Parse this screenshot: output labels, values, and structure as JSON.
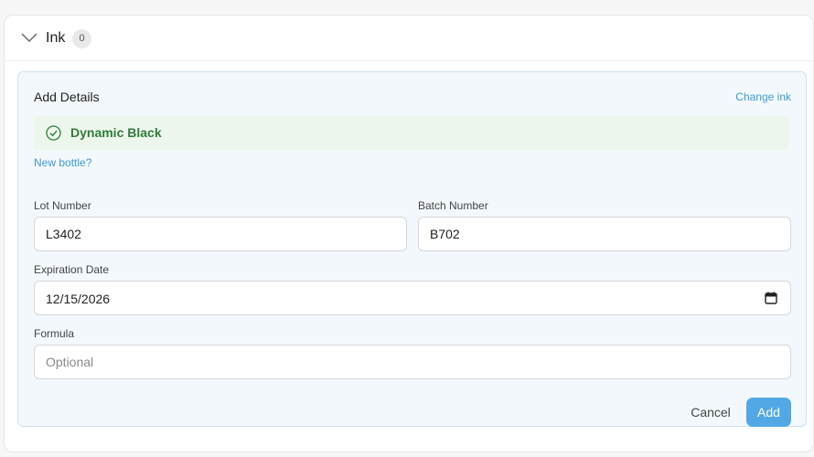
{
  "header": {
    "title": "Ink",
    "count": "0",
    "chevron_icon": "chevron-down-icon"
  },
  "details": {
    "title": "Add Details",
    "change_link": "Change ink",
    "selected_ink": "Dynamic Black",
    "selected_icon": "check-circle-icon",
    "new_bottle_link": "New bottle?"
  },
  "fields": {
    "lot": {
      "label": "Lot Number",
      "value": "L3402"
    },
    "batch": {
      "label": "Batch Number",
      "value": "B702"
    },
    "expiration": {
      "label": "Expiration Date",
      "value": "12/15/2026",
      "icon": "calendar-icon"
    },
    "formula": {
      "label": "Formula",
      "placeholder": "Optional"
    }
  },
  "actions": {
    "cancel": "Cancel",
    "add": "Add"
  },
  "colors": {
    "accent": "#52a8e4",
    "link": "#3d9ad6",
    "success_text": "#2f7d3a",
    "success_bg": "#edf6ec",
    "card_bg": "#f3f8fc",
    "card_border": "#cfe2f1"
  }
}
